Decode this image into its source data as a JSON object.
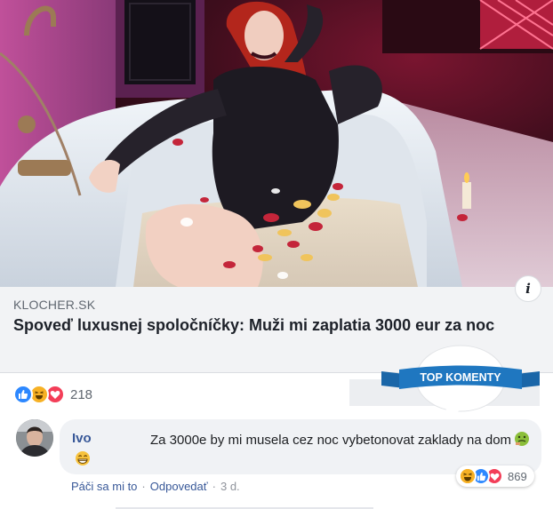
{
  "preview": {
    "domain": "KLOCHER.SK",
    "headline": "Spoveď luxusnej spoločníčky: Muži mi zaplatia 3000 eur za noc",
    "info_icon": "info-icon"
  },
  "reactions": {
    "types": [
      "like-icon",
      "haha-icon",
      "love-icon"
    ],
    "count": "218"
  },
  "badge": {
    "text": "TOP KOMENTY",
    "color": "#1f77c0"
  },
  "comment": {
    "author": "Ivo",
    "text": "Za 3000e by mi musela cez noc vybetonovat zaklady na dom",
    "emojis": [
      "nauseated-face-icon",
      "grinning-face-icon"
    ],
    "reactions": {
      "types": [
        "haha-icon",
        "like-icon",
        "love-icon"
      ],
      "count": "869"
    },
    "actions": {
      "like": "Páči sa mi to",
      "reply": "Odpovedať",
      "time": "3 d."
    }
  },
  "colors": {
    "link": "#385898",
    "like": "#2d88ff",
    "haha": "#f7b125",
    "love": "#f33e58"
  }
}
